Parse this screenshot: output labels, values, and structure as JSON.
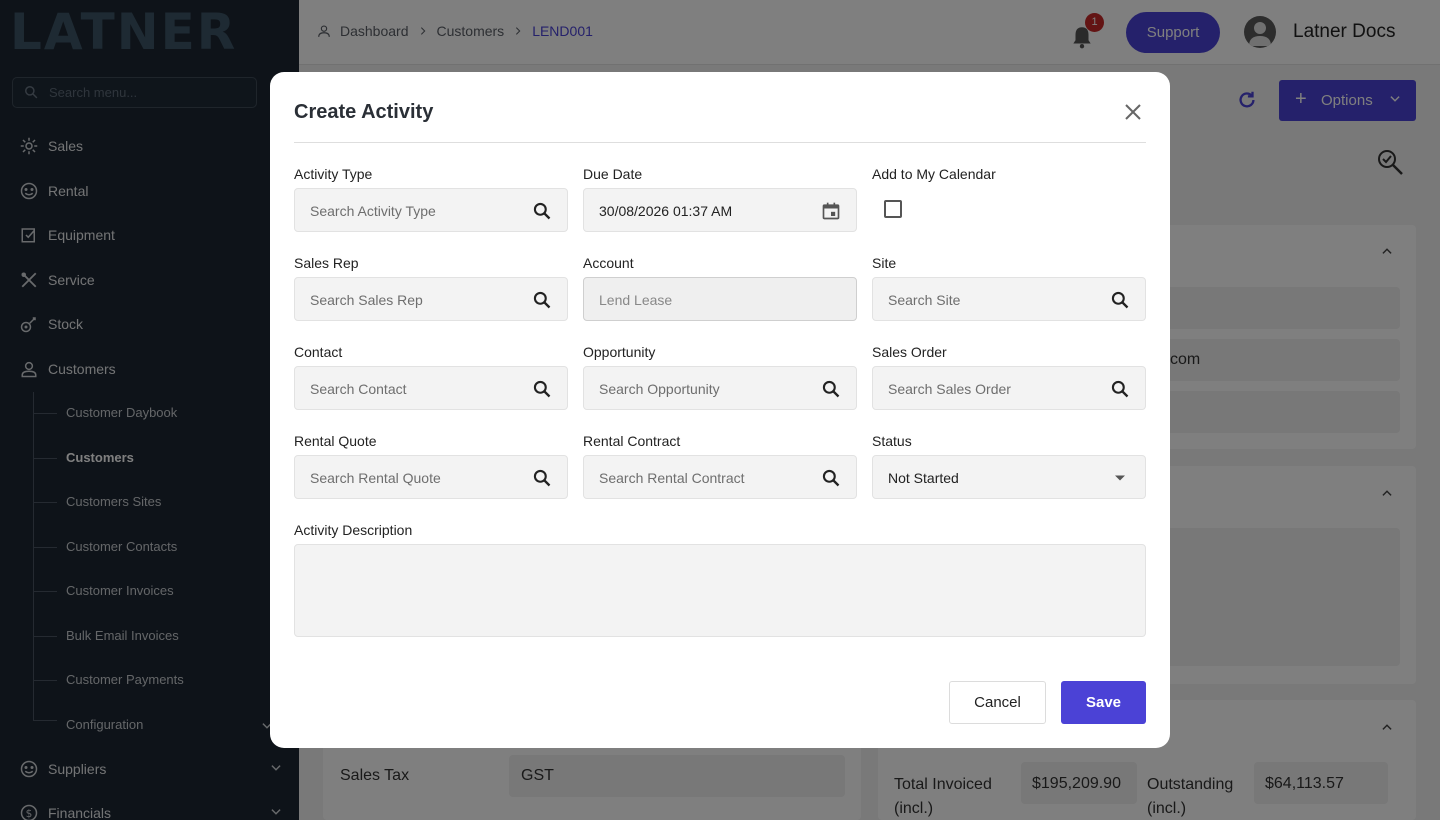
{
  "app": {
    "logo": "LATNER"
  },
  "sidebar": {
    "search_placeholder": "Search menu...",
    "items": [
      {
        "label": "Sales",
        "icon": "sales-icon"
      },
      {
        "label": "Rental",
        "icon": "rental-icon"
      },
      {
        "label": "Equipment",
        "icon": "equipment-icon"
      },
      {
        "label": "Service",
        "icon": "service-icon"
      },
      {
        "label": "Stock",
        "icon": "stock-icon"
      },
      {
        "label": "Customers",
        "icon": "customers-icon"
      },
      {
        "label": "Suppliers",
        "icon": "suppliers-icon"
      },
      {
        "label": "Financials",
        "icon": "financials-icon"
      }
    ],
    "customer_subitems": [
      {
        "label": "Customer Daybook"
      },
      {
        "label": "Customers",
        "active": true
      },
      {
        "label": "Customers Sites"
      },
      {
        "label": "Customer Contacts"
      },
      {
        "label": "Customer Invoices"
      },
      {
        "label": "Bulk Email Invoices"
      },
      {
        "label": "Customer Payments"
      },
      {
        "label": "Configuration"
      }
    ]
  },
  "header": {
    "breadcrumbs": [
      "Dashboard",
      "Customers",
      "LEND001"
    ],
    "notification_count": "1",
    "support_label": "Support",
    "user_name": "Latner Docs"
  },
  "page": {
    "options_label": "Options",
    "email_fragment": "com",
    "sales_tax_label": "Sales Tax",
    "sales_tax_value": "GST",
    "total_invoiced_label": "Total Invoiced (incl.)",
    "total_invoiced_value": "$195,209.90",
    "outstanding_label": "Outstanding (incl.)",
    "outstanding_value": "$64,113.57"
  },
  "modal": {
    "title": "Create Activity",
    "fields": {
      "activity_type": {
        "label": "Activity Type",
        "placeholder": "Search Activity Type"
      },
      "due_date": {
        "label": "Due Date",
        "value": "30/08/2026 01:37 AM"
      },
      "add_to_calendar": {
        "label": "Add to My Calendar",
        "checked": false
      },
      "sales_rep": {
        "label": "Sales Rep",
        "placeholder": "Search Sales Rep"
      },
      "account": {
        "label": "Account",
        "value": "Lend Lease"
      },
      "site": {
        "label": "Site",
        "placeholder": "Search Site"
      },
      "contact": {
        "label": "Contact",
        "placeholder": "Search Contact"
      },
      "opportunity": {
        "label": "Opportunity",
        "placeholder": "Search Opportunity"
      },
      "sales_order": {
        "label": "Sales Order",
        "placeholder": "Search Sales Order"
      },
      "rental_quote": {
        "label": "Rental Quote",
        "placeholder": "Search Rental Quote"
      },
      "rental_contract": {
        "label": "Rental Contract",
        "placeholder": "Search Rental Contract"
      },
      "status": {
        "label": "Status",
        "value": "Not Started"
      },
      "description": {
        "label": "Activity Description",
        "value": ""
      }
    },
    "cancel_label": "Cancel",
    "save_label": "Save"
  },
  "colors": {
    "accent": "#4b42d6",
    "sidebar_bg": "#1d2733",
    "badge": "#c62828"
  }
}
